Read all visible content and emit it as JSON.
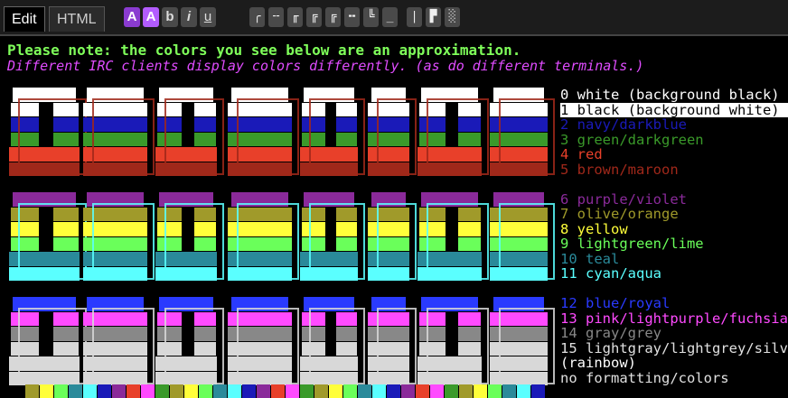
{
  "tabs": [
    {
      "label": "Edit",
      "active": true
    },
    {
      "label": "HTML",
      "active": false
    }
  ],
  "format_buttons": [
    {
      "label": "A",
      "name": "color-a-button"
    },
    {
      "label": "A",
      "name": "color-b-button"
    },
    {
      "label": "b",
      "name": "bold-button"
    },
    {
      "label": "i",
      "name": "italic-button"
    },
    {
      "label": "u",
      "name": "underline-button"
    }
  ],
  "box_glyphs": [
    "╭",
    "╌",
    "╓",
    "╔",
    "╍",
    "╚",
    "_",
    "|",
    "▛",
    "░"
  ],
  "notes": {
    "line1": "Please note: the colors you see below are an approximation.",
    "line2": "Different IRC clients display colors differently. (as do different terminals.)"
  },
  "legend": [
    {
      "text": "0  white (background black)",
      "color": "#ffffff",
      "bg": "#000000"
    },
    {
      "text": "1  black (background white)",
      "color": "#000000",
      "bg": "#ffffff"
    },
    {
      "text": "2  navy/darkblue",
      "color": "#1a1ab8",
      "bg": ""
    },
    {
      "text": "3  green/darkgreen",
      "color": "#3a9a2a",
      "bg": ""
    },
    {
      "text": "4  red",
      "color": "#e8402a",
      "bg": ""
    },
    {
      "text": "5  brown/maroon",
      "color": "#a0281a",
      "bg": ""
    },
    {
      "text": "",
      "color": "",
      "bg": ""
    },
    {
      "text": "6  purple/violet",
      "color": "#8a2a9a",
      "bg": ""
    },
    {
      "text": "7  olive/orange",
      "color": "#a09a2a",
      "bg": ""
    },
    {
      "text": "8  yellow",
      "color": "#ffff3a",
      "bg": ""
    },
    {
      "text": "9  lightgreen/lime",
      "color": "#6aff5a",
      "bg": ""
    },
    {
      "text": "10 teal",
      "color": "#2a8a9a",
      "bg": ""
    },
    {
      "text": "11 cyan/aqua",
      "color": "#5affff",
      "bg": ""
    },
    {
      "text": "",
      "color": "",
      "bg": ""
    },
    {
      "text": "12 blue/royal",
      "color": "#2a3aff",
      "bg": ""
    },
    {
      "text": "13 pink/lightpurple/fuchsia",
      "color": "#ff4aff",
      "bg": ""
    },
    {
      "text": "14 gray/grey",
      "color": "#888888",
      "bg": ""
    },
    {
      "text": "15 lightgray/lightgrey/silver",
      "color": "#e0e0e0",
      "bg": ""
    },
    {
      "text": "(rainbow)",
      "color": "#ffffff",
      "bg": ""
    },
    {
      "text": "no formatting/colors",
      "color": "#e0e0e0",
      "bg": ""
    }
  ],
  "logo_text": "COLORIZE",
  "palette": {
    "white": "#ffffff",
    "navy": "#1a1ab8",
    "green": "#3a9a2a",
    "red": "#e8402a",
    "maroon": "#a0281a",
    "purple": "#8a2a9a",
    "olive": "#a09a2a",
    "yellow": "#ffff3a",
    "lime": "#6aff5a",
    "teal": "#2a8a9a",
    "cyan": "#5affff",
    "blue": "#2a3aff",
    "pink": "#ff4aff",
    "gray": "#888888",
    "silver": "#d8d8d8"
  }
}
